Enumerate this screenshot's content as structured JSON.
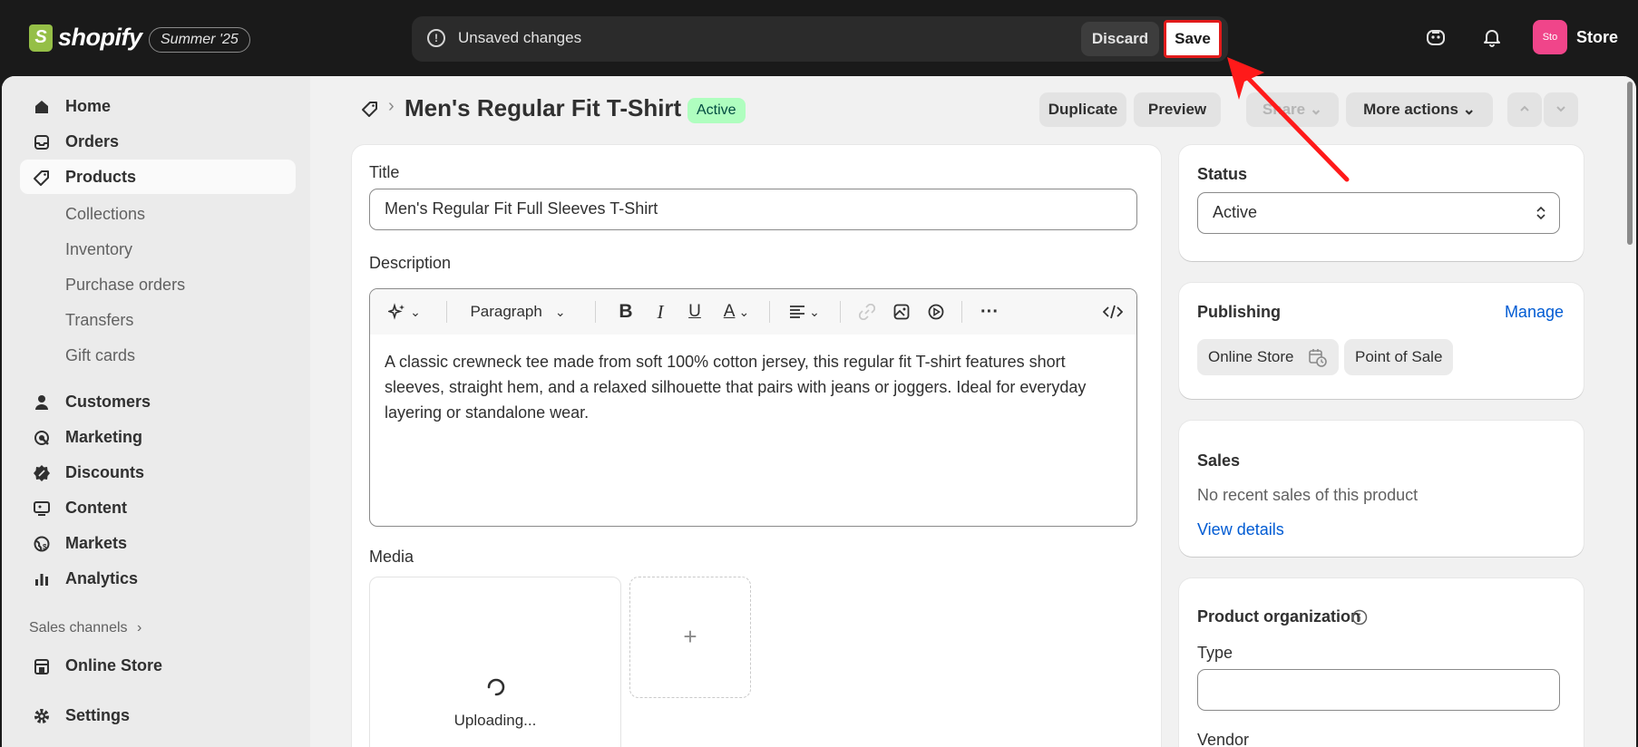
{
  "topbar": {
    "logo_text": "shopify",
    "edition_badge": "Summer '25",
    "unsaved_text": "Unsaved changes",
    "discard_label": "Discard",
    "save_label": "Save",
    "avatar_initials": "Sto",
    "store_name": "Store"
  },
  "sidebar": {
    "items": [
      {
        "label": "Home",
        "icon": "home-icon"
      },
      {
        "label": "Orders",
        "icon": "inbox-icon"
      },
      {
        "label": "Products",
        "icon": "tag-icon",
        "active": true
      },
      {
        "label": "Collections",
        "sub": true
      },
      {
        "label": "Inventory",
        "sub": true
      },
      {
        "label": "Purchase orders",
        "sub": true
      },
      {
        "label": "Transfers",
        "sub": true
      },
      {
        "label": "Gift cards",
        "sub": true
      },
      {
        "label": "Customers",
        "icon": "person-icon"
      },
      {
        "label": "Marketing",
        "icon": "target-icon"
      },
      {
        "label": "Discounts",
        "icon": "discount-icon"
      },
      {
        "label": "Content",
        "icon": "content-icon"
      },
      {
        "label": "Markets",
        "icon": "globe-icon"
      },
      {
        "label": "Analytics",
        "icon": "bar-chart-icon"
      }
    ],
    "sales_channels_label": "Sales channels",
    "online_store_label": "Online Store",
    "settings_label": "Settings"
  },
  "page": {
    "title": "Men's Regular Fit T-Shirt",
    "status_badge": "Active",
    "buttons": {
      "duplicate": "Duplicate",
      "preview": "Preview",
      "share": "Share",
      "more_actions": "More actions"
    }
  },
  "product_form": {
    "title_label": "Title",
    "title_value": "Men's Regular Fit Full Sleeves T-Shirt",
    "description_label": "Description",
    "paragraph_select": "Paragraph",
    "description_text": "A classic crewneck tee made from soft 100% cotton jersey, this regular fit T-shirt features short sleeves, straight hem, and a relaxed silhouette that pairs with jeans or joggers. Ideal for everyday layering or standalone wear.",
    "media_label": "Media",
    "uploading_text": "Uploading...",
    "add_media_symbol": "+"
  },
  "status_card": {
    "title": "Status",
    "selected": "Active"
  },
  "publishing_card": {
    "title": "Publishing",
    "manage_label": "Manage",
    "channels": [
      "Online Store",
      "Point of Sale"
    ]
  },
  "sales_card": {
    "title": "Sales",
    "text": "No recent sales of this product",
    "link": "View details"
  },
  "organization_card": {
    "title": "Product organization",
    "type_label": "Type",
    "type_value": "",
    "vendor_label": "Vendor"
  },
  "colors": {
    "accent_save_border": "#e21b1b",
    "link": "#005bd3",
    "status_badge_bg": "#affebf"
  }
}
